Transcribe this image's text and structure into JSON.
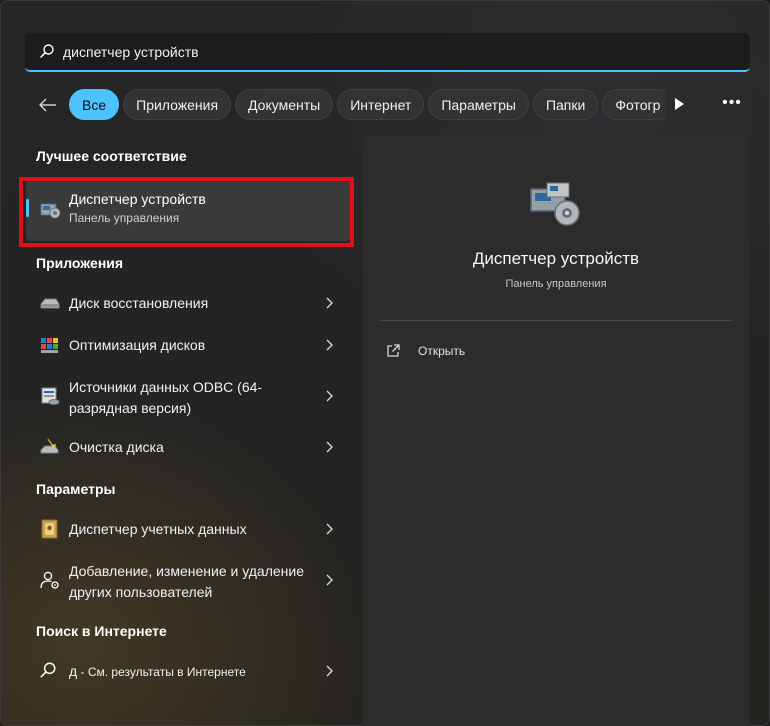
{
  "search": {
    "value": "диспетчер устройств"
  },
  "filters": [
    {
      "label": "Все",
      "active": true
    },
    {
      "label": "Приложения",
      "active": false
    },
    {
      "label": "Документы",
      "active": false
    },
    {
      "label": "Интернет",
      "active": false
    },
    {
      "label": "Параметры",
      "active": false
    },
    {
      "label": "Папки",
      "active": false
    },
    {
      "label": "Фотогр",
      "active": false
    }
  ],
  "sections": {
    "best_match": "Лучшее соответствие",
    "apps": "Приложения",
    "settings": "Параметры",
    "web": "Поиск в Интернете"
  },
  "best_match": {
    "title": "Диспетчер устройств",
    "subtitle": "Панель управления",
    "icon": "device-manager-icon"
  },
  "apps": [
    {
      "label": "Диск восстановления",
      "icon": "recovery-drive-icon"
    },
    {
      "label": "Оптимизация дисков",
      "icon": "defragment-icon"
    },
    {
      "label": "Источники данных ODBC (64-разрядная версия)",
      "icon": "odbc-icon"
    },
    {
      "label": "Очистка диска",
      "icon": "disk-cleanup-icon"
    }
  ],
  "settings": [
    {
      "label": "Диспетчер учетных данных",
      "icon": "credential-manager-icon"
    },
    {
      "label": "Добавление, изменение и удаление других пользователей",
      "icon": "user-settings-icon"
    }
  ],
  "web": {
    "query": "д",
    "suffix": "- См. результаты в Интернете"
  },
  "preview": {
    "title": "Диспетчер устройств",
    "subtitle": "Панель управления",
    "open_label": "Открыть"
  },
  "colors": {
    "accent": "#4cc2ff",
    "highlight": "#e0101a"
  }
}
